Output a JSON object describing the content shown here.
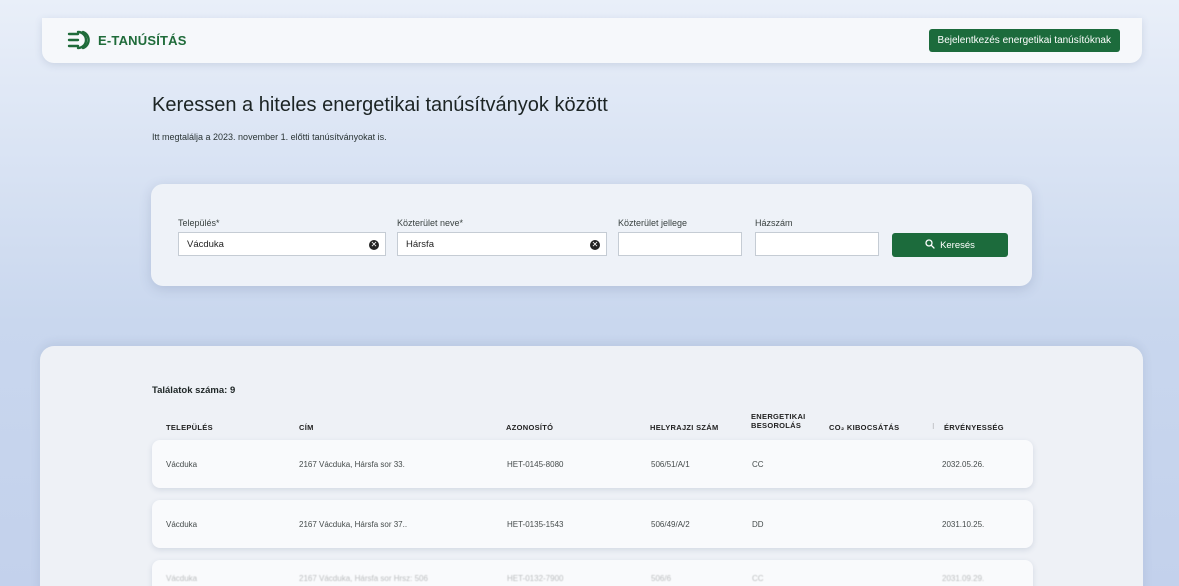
{
  "header": {
    "logo_text": "E-TANÚSÍTÁS",
    "login_label": "Bejelentkezés energetikai tanúsítóknak"
  },
  "hero": {
    "title": "Keressen a hiteles energetikai tanúsítványok között",
    "subtitle": "Itt megtalálja a 2023. november 1. előtti tanúsítványokat is."
  },
  "search": {
    "fields": [
      {
        "label": "Település*",
        "value": "Vácduka"
      },
      {
        "label": "Közterület neve*",
        "value": "Hársfa"
      },
      {
        "label": "Közterület jellege",
        "value": ""
      },
      {
        "label": "Házszám",
        "value": ""
      }
    ],
    "button_label": "Keresés"
  },
  "results": {
    "count_label": "Találatok száma: 9",
    "columns": [
      "TELEPÜLÉS",
      "CÍM",
      "AZONOSÍTÓ",
      "HELYRAJZI SZÁM",
      "ENERGETIKAI BESOROLÁS",
      "CO₂ KIBOCSÁTÁS",
      "ÉRVÉNYESSÉG"
    ],
    "rows": [
      [
        "Vácduka",
        "2167 Vácduka, Hársfa sor 33.",
        "HET-0145-8080",
        "506/51/A/1",
        "CC",
        "2032.05.26."
      ],
      [
        "Vácduka",
        "2167 Vácduka, Hársfa sor 37..",
        "HET-0135-1543",
        "506/49/A/2",
        "DD",
        "2031.10.25."
      ],
      [
        "Vácduka",
        "2167 Vácduka, Hársfa sor Hrsz: 506",
        "HET-0132-7900",
        "506/6",
        "CC",
        "2031.09.29."
      ]
    ]
  },
  "colors": {
    "brand_green": "#1c6b3c"
  }
}
